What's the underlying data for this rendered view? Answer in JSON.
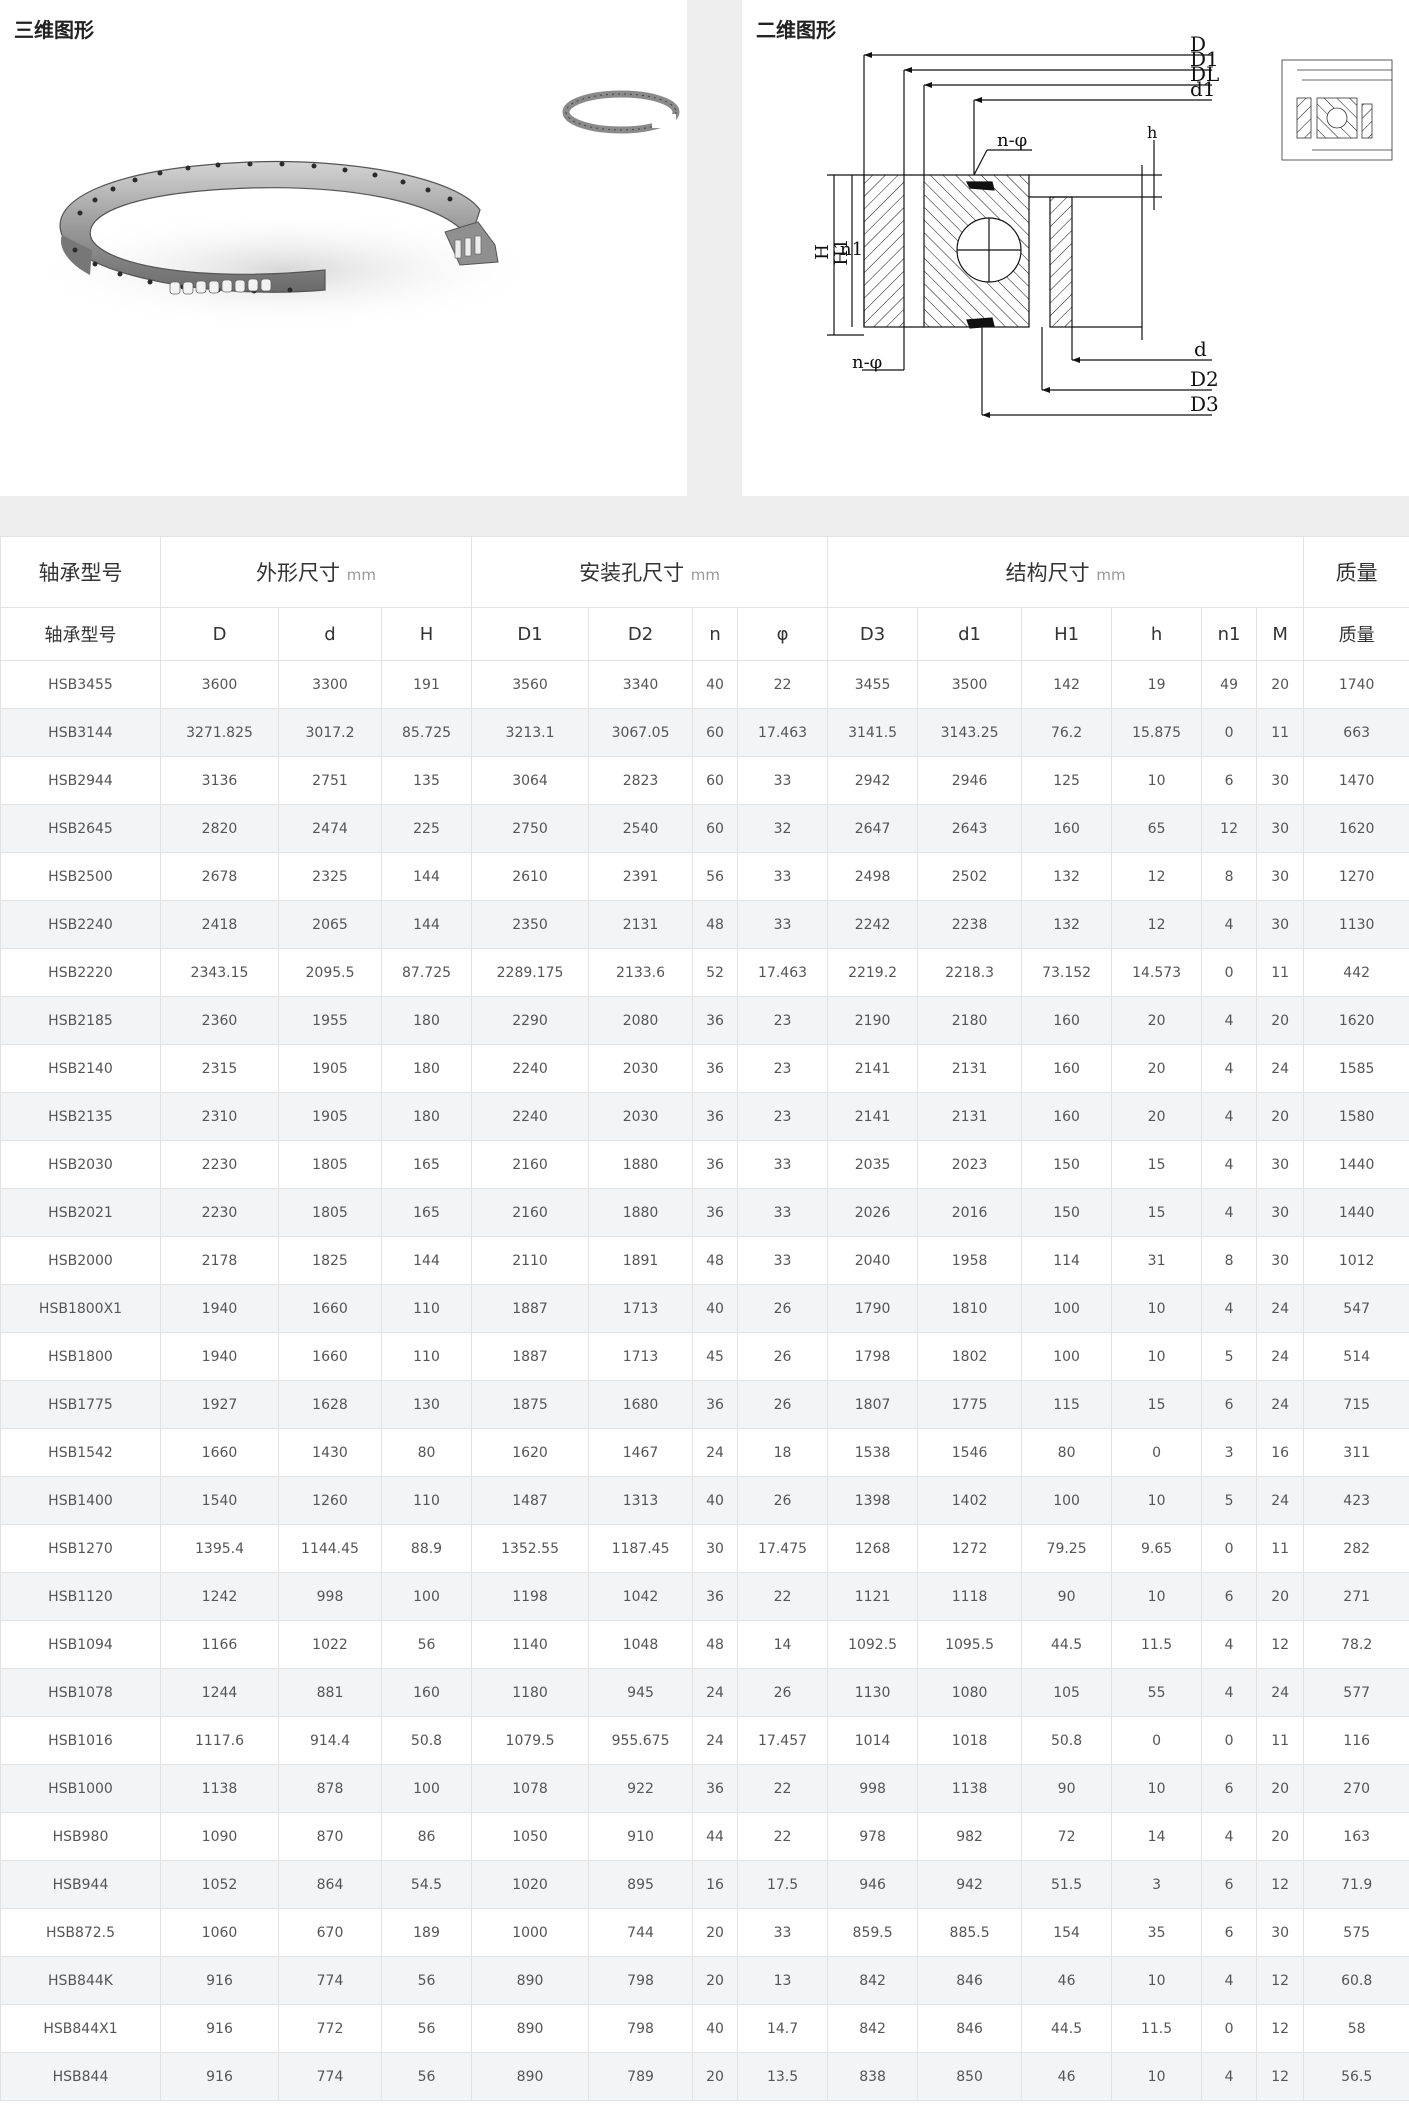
{
  "views": {
    "view_3d_title": "三维图形",
    "view_2d_title": "二维图形",
    "drawing_labels": {
      "D": "D",
      "D1": "D1",
      "DL": "DL",
      "d1": "d1",
      "n_phi_top": "n-φ",
      "h": "h",
      "H": "H",
      "H1": "H1",
      "n1": "n1",
      "n_phi_bottom": "n-φ",
      "d": "d",
      "D2": "D2",
      "D3": "D3"
    }
  },
  "table": {
    "group_headers": [
      {
        "label": "轴承型号",
        "unit": ""
      },
      {
        "label": "外形尺寸",
        "unit": "mm"
      },
      {
        "label": "安装孔尺寸",
        "unit": "mm"
      },
      {
        "label": "结构尺寸",
        "unit": "mm"
      },
      {
        "label": "质量",
        "unit": ""
      }
    ],
    "columns": [
      "轴承型号",
      "D",
      "d",
      "H",
      "D1",
      "D2",
      "n",
      "φ",
      "D3",
      "d1",
      "H1",
      "h",
      "n1",
      "M",
      "质量"
    ],
    "rows": [
      [
        "HSB3455",
        "3600",
        "3300",
        "191",
        "3560",
        "3340",
        "40",
        "22",
        "3455",
        "3500",
        "142",
        "19",
        "49",
        "20",
        "1740"
      ],
      [
        "HSB3144",
        "3271.825",
        "3017.2",
        "85.725",
        "3213.1",
        "3067.05",
        "60",
        "17.463",
        "3141.5",
        "3143.25",
        "76.2",
        "15.875",
        "0",
        "11",
        "663"
      ],
      [
        "HSB2944",
        "3136",
        "2751",
        "135",
        "3064",
        "2823",
        "60",
        "33",
        "2942",
        "2946",
        "125",
        "10",
        "6",
        "30",
        "1470"
      ],
      [
        "HSB2645",
        "2820",
        "2474",
        "225",
        "2750",
        "2540",
        "60",
        "32",
        "2647",
        "2643",
        "160",
        "65",
        "12",
        "30",
        "1620"
      ],
      [
        "HSB2500",
        "2678",
        "2325",
        "144",
        "2610",
        "2391",
        "56",
        "33",
        "2498",
        "2502",
        "132",
        "12",
        "8",
        "30",
        "1270"
      ],
      [
        "HSB2240",
        "2418",
        "2065",
        "144",
        "2350",
        "2131",
        "48",
        "33",
        "2242",
        "2238",
        "132",
        "12",
        "4",
        "30",
        "1130"
      ],
      [
        "HSB2220",
        "2343.15",
        "2095.5",
        "87.725",
        "2289.175",
        "2133.6",
        "52",
        "17.463",
        "2219.2",
        "2218.3",
        "73.152",
        "14.573",
        "0",
        "11",
        "442"
      ],
      [
        "HSB2185",
        "2360",
        "1955",
        "180",
        "2290",
        "2080",
        "36",
        "23",
        "2190",
        "2180",
        "160",
        "20",
        "4",
        "20",
        "1620"
      ],
      [
        "HSB2140",
        "2315",
        "1905",
        "180",
        "2240",
        "2030",
        "36",
        "23",
        "2141",
        "2131",
        "160",
        "20",
        "4",
        "24",
        "1585"
      ],
      [
        "HSB2135",
        "2310",
        "1905",
        "180",
        "2240",
        "2030",
        "36",
        "23",
        "2141",
        "2131",
        "160",
        "20",
        "4",
        "20",
        "1580"
      ],
      [
        "HSB2030",
        "2230",
        "1805",
        "165",
        "2160",
        "1880",
        "36",
        "33",
        "2035",
        "2023",
        "150",
        "15",
        "4",
        "30",
        "1440"
      ],
      [
        "HSB2021",
        "2230",
        "1805",
        "165",
        "2160",
        "1880",
        "36",
        "33",
        "2026",
        "2016",
        "150",
        "15",
        "4",
        "30",
        "1440"
      ],
      [
        "HSB2000",
        "2178",
        "1825",
        "144",
        "2110",
        "1891",
        "48",
        "33",
        "2040",
        "1958",
        "114",
        "31",
        "8",
        "30",
        "1012"
      ],
      [
        "HSB1800X1",
        "1940",
        "1660",
        "110",
        "1887",
        "1713",
        "40",
        "26",
        "1790",
        "1810",
        "100",
        "10",
        "4",
        "24",
        "547"
      ],
      [
        "HSB1800",
        "1940",
        "1660",
        "110",
        "1887",
        "1713",
        "45",
        "26",
        "1798",
        "1802",
        "100",
        "10",
        "5",
        "24",
        "514"
      ],
      [
        "HSB1775",
        "1927",
        "1628",
        "130",
        "1875",
        "1680",
        "36",
        "26",
        "1807",
        "1775",
        "115",
        "15",
        "6",
        "24",
        "715"
      ],
      [
        "HSB1542",
        "1660",
        "1430",
        "80",
        "1620",
        "1467",
        "24",
        "18",
        "1538",
        "1546",
        "80",
        "0",
        "3",
        "16",
        "311"
      ],
      [
        "HSB1400",
        "1540",
        "1260",
        "110",
        "1487",
        "1313",
        "40",
        "26",
        "1398",
        "1402",
        "100",
        "10",
        "5",
        "24",
        "423"
      ],
      [
        "HSB1270",
        "1395.4",
        "1144.45",
        "88.9",
        "1352.55",
        "1187.45",
        "30",
        "17.475",
        "1268",
        "1272",
        "79.25",
        "9.65",
        "0",
        "11",
        "282"
      ],
      [
        "HSB1120",
        "1242",
        "998",
        "100",
        "1198",
        "1042",
        "36",
        "22",
        "1121",
        "1118",
        "90",
        "10",
        "6",
        "20",
        "271"
      ],
      [
        "HSB1094",
        "1166",
        "1022",
        "56",
        "1140",
        "1048",
        "48",
        "14",
        "1092.5",
        "1095.5",
        "44.5",
        "11.5",
        "4",
        "12",
        "78.2"
      ],
      [
        "HSB1078",
        "1244",
        "881",
        "160",
        "1180",
        "945",
        "24",
        "26",
        "1130",
        "1080",
        "105",
        "55",
        "4",
        "24",
        "577"
      ],
      [
        "HSB1016",
        "1117.6",
        "914.4",
        "50.8",
        "1079.5",
        "955.675",
        "24",
        "17.457",
        "1014",
        "1018",
        "50.8",
        "0",
        "0",
        "11",
        "116"
      ],
      [
        "HSB1000",
        "1138",
        "878",
        "100",
        "1078",
        "922",
        "36",
        "22",
        "998",
        "1138",
        "90",
        "10",
        "6",
        "20",
        "270"
      ],
      [
        "HSB980",
        "1090",
        "870",
        "86",
        "1050",
        "910",
        "44",
        "22",
        "978",
        "982",
        "72",
        "14",
        "4",
        "20",
        "163"
      ],
      [
        "HSB944",
        "1052",
        "864",
        "54.5",
        "1020",
        "895",
        "16",
        "17.5",
        "946",
        "942",
        "51.5",
        "3",
        "6",
        "12",
        "71.9"
      ],
      [
        "HSB872.5",
        "1060",
        "670",
        "189",
        "1000",
        "744",
        "20",
        "33",
        "859.5",
        "885.5",
        "154",
        "35",
        "6",
        "30",
        "575"
      ],
      [
        "HSB844K",
        "916",
        "774",
        "56",
        "890",
        "798",
        "20",
        "13",
        "842",
        "846",
        "46",
        "10",
        "4",
        "12",
        "60.8"
      ],
      [
        "HSB844X1",
        "916",
        "772",
        "56",
        "890",
        "798",
        "40",
        "14.7",
        "842",
        "846",
        "44.5",
        "11.5",
        "0",
        "12",
        "58"
      ],
      [
        "HSB844",
        "916",
        "774",
        "56",
        "890",
        "789",
        "20",
        "13.5",
        "838",
        "850",
        "46",
        "10",
        "4",
        "12",
        "56.5"
      ]
    ]
  }
}
